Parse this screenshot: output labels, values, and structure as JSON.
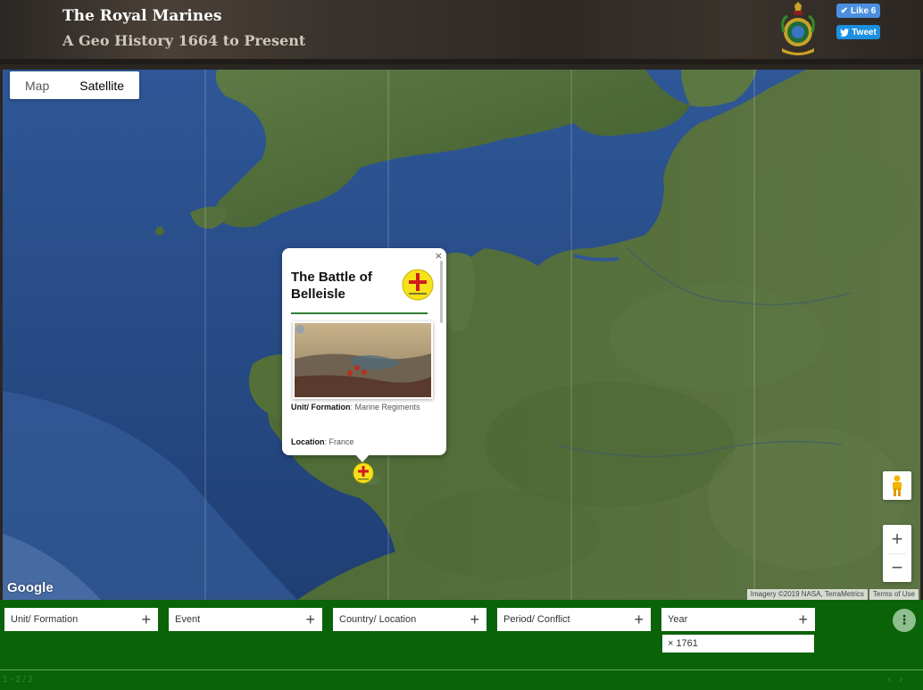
{
  "header": {
    "title": "The Royal Marines",
    "subtitle": "A Geo History 1664 to Present",
    "like_label": "Like 6",
    "tweet_label": "Tweet"
  },
  "map": {
    "type_buttons": [
      "Map",
      "Satellite"
    ],
    "selected_type": "Satellite",
    "zoom_in": "+",
    "zoom_out": "−",
    "logo": "Google",
    "attribution": "Imagery ©2019 NASA, TerraMetrics",
    "terms": "Terms of Use"
  },
  "infowindow": {
    "close": "×",
    "title": "The Battle of Belleisle",
    "unit_label": "Unit/ Formation",
    "unit_value": ": Marine Regiments",
    "location_label": "Location",
    "location_value": ": France"
  },
  "filters": {
    "items": [
      "Unit/ Formation",
      "Event",
      "Country/ Location",
      "Period/ Conflict",
      "Year"
    ],
    "year_chip": "1761",
    "chip_remove": "×",
    "more": "⋮"
  },
  "pager": {
    "text": "1 - 2 / 2",
    "prev": "‹",
    "next": "›"
  },
  "icons": {
    "crest": "royal-marines-crest-icon",
    "marker": "regiments-of-marines-marker-icon",
    "pegman": "street-view-pegman-icon"
  },
  "colors": {
    "filter_bar": "#0a6308",
    "social": "#1d8fe1",
    "sea": "#284b86",
    "land": "#4f6b3a"
  }
}
